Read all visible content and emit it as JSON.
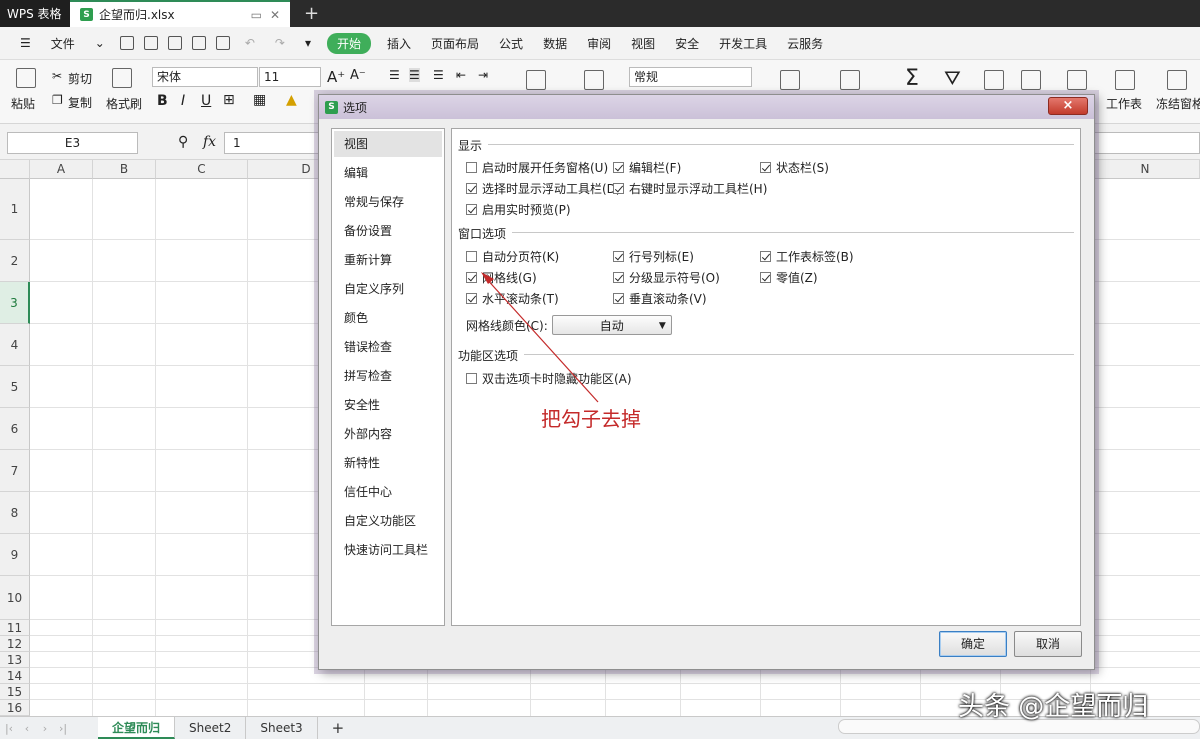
{
  "titlebar": {
    "app_tab": "WPS 表格",
    "doc_tab": "企望而归.xlsx",
    "new_tab": "+"
  },
  "menubar": {
    "file": "文件",
    "tabs": [
      "开始",
      "插入",
      "页面布局",
      "公式",
      "数据",
      "审阅",
      "视图",
      "安全",
      "开发工具",
      "云服务"
    ]
  },
  "ribbon": {
    "paste": "粘贴",
    "cut": "剪切",
    "copy": "复制",
    "format_painter": "格式刷",
    "font_name": "宋体",
    "font_size": "11",
    "number_format": "常规",
    "worksheet": "工作表",
    "freeze": "冻结窗格"
  },
  "formula": {
    "cell_ref": "E3",
    "fx": "fx",
    "value": "1"
  },
  "sheet": {
    "columns": [
      "A",
      "B",
      "C",
      "D",
      "N"
    ],
    "rows": [
      "1",
      "2",
      "3",
      "4",
      "5",
      "6",
      "7",
      "8",
      "9",
      "10",
      "11",
      "12",
      "13",
      "14",
      "15",
      "16"
    ],
    "tabs": [
      "企望而归",
      "Sheet2",
      "Sheet3"
    ],
    "add_tab": "+"
  },
  "dialog": {
    "title": "选项",
    "close": "×",
    "nav": [
      "视图",
      "编辑",
      "常规与保存",
      "备份设置",
      "重新计算",
      "自定义序列",
      "颜色",
      "错误检查",
      "拼写检查",
      "安全性",
      "外部内容",
      "新特性",
      "信任中心",
      "自定义功能区",
      "快速访问工具栏"
    ],
    "display": {
      "heading": "显示",
      "options": [
        {
          "label": "启动时展开任务窗格(U)",
          "checked": false
        },
        {
          "label": "编辑栏(F)",
          "checked": true
        },
        {
          "label": "状态栏(S)",
          "checked": true
        },
        {
          "label": "选择时显示浮动工具栏(D)",
          "checked": true
        },
        {
          "label": "右键时显示浮动工具栏(H)",
          "checked": true
        },
        {
          "label": "启用实时预览(P)",
          "checked": true
        }
      ]
    },
    "window": {
      "heading": "窗口选项",
      "options": [
        {
          "label": "自动分页符(K)",
          "checked": false
        },
        {
          "label": "行号列标(E)",
          "checked": true
        },
        {
          "label": "工作表标签(B)",
          "checked": true
        },
        {
          "label": "网格线(G)",
          "checked": true
        },
        {
          "label": "分级显示符号(O)",
          "checked": true
        },
        {
          "label": "零值(Z)",
          "checked": true
        },
        {
          "label": "水平滚动条(T)",
          "checked": true
        },
        {
          "label": "垂直滚动条(V)",
          "checked": true
        }
      ],
      "grid_color_label": "网格线颜色(C):",
      "grid_color_value": "自动"
    },
    "ribbon_section": {
      "heading": "功能区选项",
      "options": [
        {
          "label": "双击选项卡时隐藏功能区(A)",
          "checked": false
        }
      ]
    },
    "ok": "确定",
    "cancel": "取消"
  },
  "annotation": "把勾子去掉",
  "watermark": "头条 @企望而归",
  "colors": {
    "accent": "#2e8b57",
    "annotation": "#c42a2a"
  }
}
